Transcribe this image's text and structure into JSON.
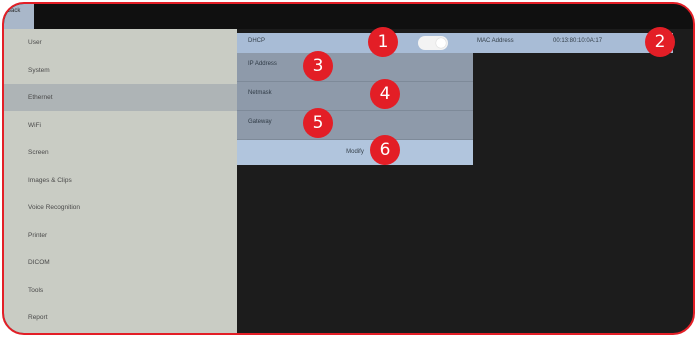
{
  "topbar": {
    "tab_label": "Back"
  },
  "sidebar": {
    "items": [
      {
        "label": "User"
      },
      {
        "label": "System"
      },
      {
        "label": "Ethernet"
      },
      {
        "label": "WiFi"
      },
      {
        "label": "Screen"
      },
      {
        "label": "Images & Clips"
      },
      {
        "label": "Voice Recognition"
      },
      {
        "label": "Printer"
      },
      {
        "label": "DICOM"
      },
      {
        "label": "Tools"
      },
      {
        "label": "Report"
      }
    ],
    "selected": "Ethernet"
  },
  "ethernet": {
    "dhcp_label": "DHCP",
    "dhcp_enabled": true,
    "mac_label": "MAC Address",
    "mac_value": "00:13:80:10:0A:17",
    "fields": [
      {
        "label": "IP Address"
      },
      {
        "label": "Netmask"
      },
      {
        "label": "Gateway"
      }
    ],
    "modify_label": "Modify"
  },
  "callouts": [
    "1",
    "2",
    "3",
    "4",
    "5",
    "6"
  ],
  "colors": {
    "callout": "#e31e26",
    "selected_row": "#aeb4b6",
    "settings_row": "#a8bcd6"
  }
}
